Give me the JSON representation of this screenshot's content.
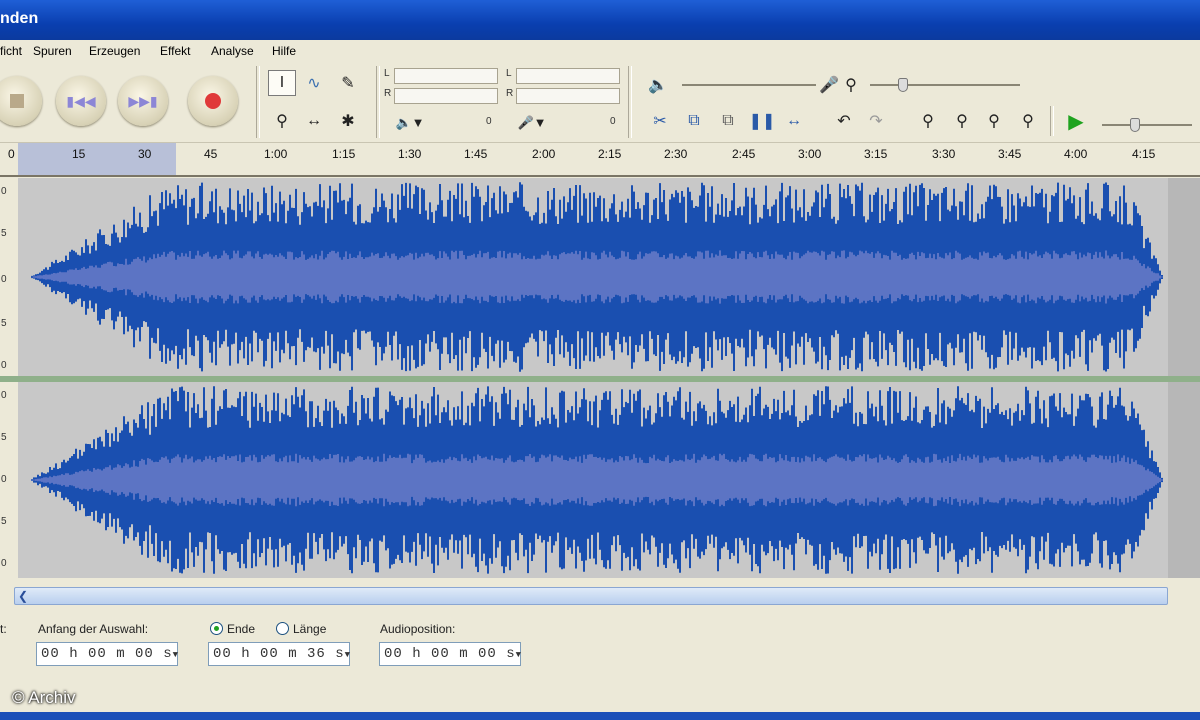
{
  "window": {
    "title": "nden"
  },
  "menu": [
    "ficht",
    "Spuren",
    "Erzeugen",
    "Effekt",
    "Analyse",
    "Hilfe"
  ],
  "transport": {
    "stop_icon": "stop-icon",
    "skip_start_icon": "skip-start-icon",
    "skip_end_icon": "skip-end-icon",
    "record_icon": "record-icon",
    "colors": {
      "stop": "#b9a98a",
      "skip": "#8c86d6",
      "record": "#e03a3a"
    }
  },
  "meters": {
    "play": {
      "L": "L",
      "R": "R",
      "value": "0"
    },
    "record": {
      "L": "L",
      "R": "R",
      "value": "0"
    }
  },
  "timeline": {
    "ticks": [
      "0",
      "15",
      "30",
      "45",
      "1:00",
      "1:15",
      "1:30",
      "1:45",
      "2:00",
      "2:15",
      "2:30",
      "2:45",
      "3:00",
      "3:15",
      "3:30",
      "3:45",
      "4:00",
      "4:15"
    ],
    "selected_range": [
      "0",
      "30"
    ]
  },
  "waveform": {
    "color": "#1a4fb0",
    "rms_color": "#5c74c4",
    "background": "#c8c8c8"
  },
  "track_scale": [
    "0",
    "5",
    "0",
    "5",
    "0"
  ],
  "selection": {
    "start_label": "Anfang der Auswahl:",
    "start_value": "00 h 00 m 00 s",
    "end_label": "Ende",
    "length_label": "Länge",
    "end_value": "00 h 00 m 36 s",
    "mode_selected": "Ende",
    "position_label": "Audioposition:",
    "position_value": "00 h 00 m 00 s",
    "left_label": "t:"
  },
  "watermark": "© Archiv"
}
